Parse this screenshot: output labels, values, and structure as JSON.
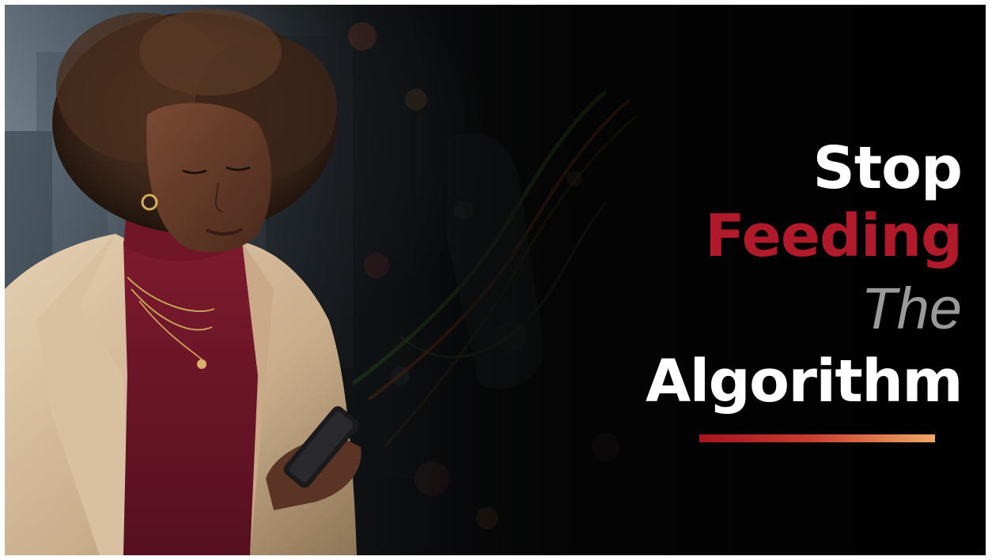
{
  "headline": {
    "word1": "Stop",
    "word2": "Feeding",
    "word3": "The",
    "word4": "Algorithm"
  },
  "colors": {
    "background": "#070707",
    "accent_red": "#b01a2a",
    "muted_gray": "#9a9a9a",
    "text_white": "#ffffff",
    "bar_gradient_start": "#a7141f",
    "bar_gradient_end": "#f0a866"
  },
  "illustration": {
    "subject": "woman-looking-at-phone",
    "coat_color": "#d9c1a3",
    "sweater_color": "#6b1525",
    "hair_color": "#3a2418",
    "skin_color": "#5a3424"
  }
}
